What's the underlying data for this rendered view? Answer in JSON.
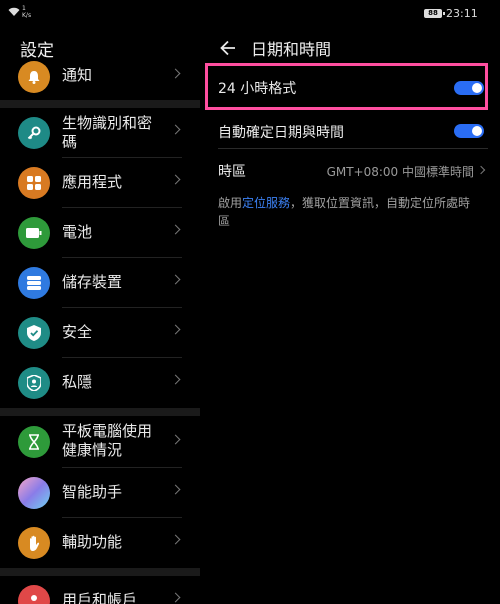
{
  "status_bar": {
    "net_speed_value": "1",
    "net_speed_unit": "K/s",
    "battery": "88",
    "time": "23:11"
  },
  "sidebar": {
    "title": "設定",
    "items": [
      {
        "label": "通知",
        "icon": "bell-icon",
        "color": "#d88a22"
      },
      {
        "label": "生物識別和密碼",
        "icon": "key-icon",
        "color": "#1e8a86"
      },
      {
        "label": "應用程式",
        "icon": "apps-grid-icon",
        "color": "#d87a22"
      },
      {
        "label": "電池",
        "icon": "battery-icon",
        "color": "#2e9a3a"
      },
      {
        "label": "儲存裝置",
        "icon": "storage-icon",
        "color": "#2f7ae0"
      },
      {
        "label": "安全",
        "icon": "shield-check-icon",
        "color": "#1f8c86"
      },
      {
        "label": "私隱",
        "icon": "privacy-shield-icon",
        "color": "#1f8c86"
      },
      {
        "label": "平板電腦使用健康情況",
        "icon": "hourglass-icon",
        "color": "#2e9a3a"
      },
      {
        "label": "智能助手",
        "icon": "assistant-icon",
        "color": "#8a7ce8"
      },
      {
        "label": "輔助功能",
        "icon": "hand-icon",
        "color": "#d88a22"
      },
      {
        "label": "用戶和帳戶",
        "icon": "user-icon",
        "color": "#e04848"
      }
    ]
  },
  "detail": {
    "title": "日期和時間",
    "rows": [
      {
        "label": "24 小時格式",
        "toggle_on": true
      },
      {
        "label": "自動確定日期與時間",
        "toggle_on": true
      }
    ],
    "timezone": {
      "label": "時區",
      "value": "GMT+08:00 中國標準時間"
    },
    "info_prefix": "啟用",
    "info_link": "定位服務",
    "info_suffix": "，獲取位置資訊，自動定位所處時區"
  },
  "colors": {
    "accent": "#2a6df4",
    "highlight": "#ff4fa0",
    "link": "#3c82f5"
  }
}
